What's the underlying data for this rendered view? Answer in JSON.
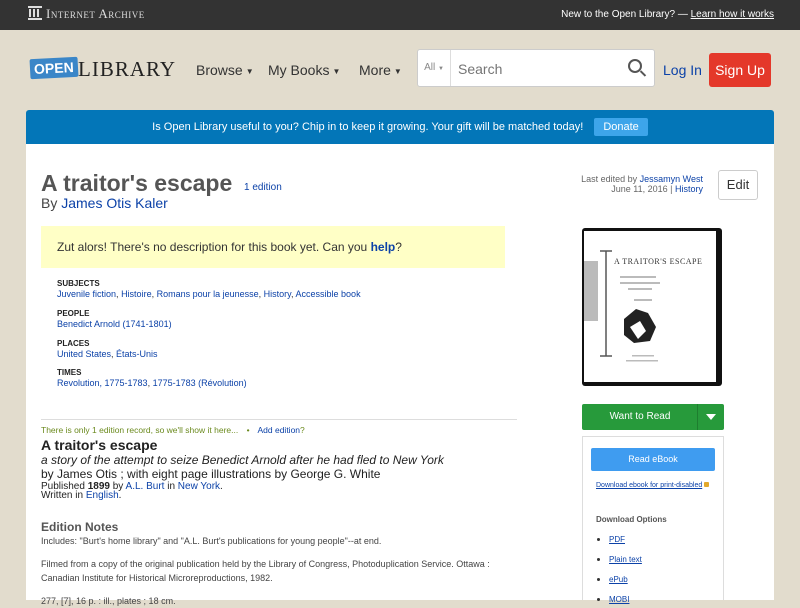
{
  "ia_bar": {
    "logo_text": "Internet Archive",
    "message": "New to the Open Library? —",
    "message_link": "Learn how it works"
  },
  "header": {
    "logo_open": "OPEN",
    "logo_library": "LIBRARY",
    "nav": [
      "Browse",
      "My Books",
      "More"
    ],
    "search_scope": "All",
    "search_placeholder": "Search",
    "login": "Log In",
    "signup": "Sign Up"
  },
  "donate": {
    "text": "Is Open Library useful to you? Chip in to keep it growing. Your gift will be matched today!",
    "button": "Donate"
  },
  "book": {
    "title": "A traitor's escape",
    "edition_count": "1 edition",
    "by_label": "By",
    "author": "James Otis Kaler",
    "last_edited_label": "Last edited by",
    "last_edited_by": "Jessamyn West",
    "last_edited_date": "June 11, 2016",
    "history_link": "History",
    "edit_button": "Edit",
    "no_description": "Zut alors! There's no description for this book yet. Can you",
    "help_link": "help",
    "help_suffix": "?"
  },
  "subjects": {
    "heading": "SUBJECTS",
    "items": [
      "Juvenile fiction",
      "Histoire",
      "Romans pour la jeunesse",
      "History",
      "Accessible book"
    ]
  },
  "people": {
    "heading": "PEOPLE",
    "items": [
      "Benedict Arnold (1741-1801)"
    ]
  },
  "places": {
    "heading": "PLACES",
    "items": [
      "United States",
      "États-Unis"
    ]
  },
  "times": {
    "heading": "TIMES",
    "items": [
      "Revolution, 1775-1783",
      "1775-1783 (Révolution)"
    ]
  },
  "edition": {
    "only_note": "There is only 1 edition record, so we'll show it here...",
    "bullet": "•",
    "add_edition": "Add edition",
    "add_edition_suffix": "?",
    "title": "A traitor's escape",
    "subtitle": "a story of the attempt to seize Benedict Arnold after he had fled to New York",
    "by_statement": "by James Otis ; with eight page illustrations by George G. White",
    "published_label": "Published",
    "year": "1899",
    "by_word": "by",
    "publisher": "A.L. Burt",
    "in_word": "in",
    "place": "New York",
    "written_label": "Written in",
    "language": "English",
    "notes_heading": "Edition Notes",
    "notes": [
      "Includes: \"Burt's home library\" and \"A.L. Burt's publications for young people\"--at end.",
      "Filmed from a copy of the original publication held by the Library of Congress, Photoduplication Service. Ottawa : Canadian Institute for Historical Microreproductions, 1982.",
      "277, [7], 16 p. : ill., plates ; 18 cm."
    ]
  },
  "cover_text": {
    "title": "A TRAITOR'S ESCAPE"
  },
  "sidebar": {
    "want_to_read": "Want to Read",
    "read_ebook": "Read eBook",
    "download_print": "Download ebook for print-disabled",
    "download_options": "Download Options",
    "formats": [
      "PDF",
      "Plain text",
      "ePub",
      "MOBI"
    ]
  }
}
